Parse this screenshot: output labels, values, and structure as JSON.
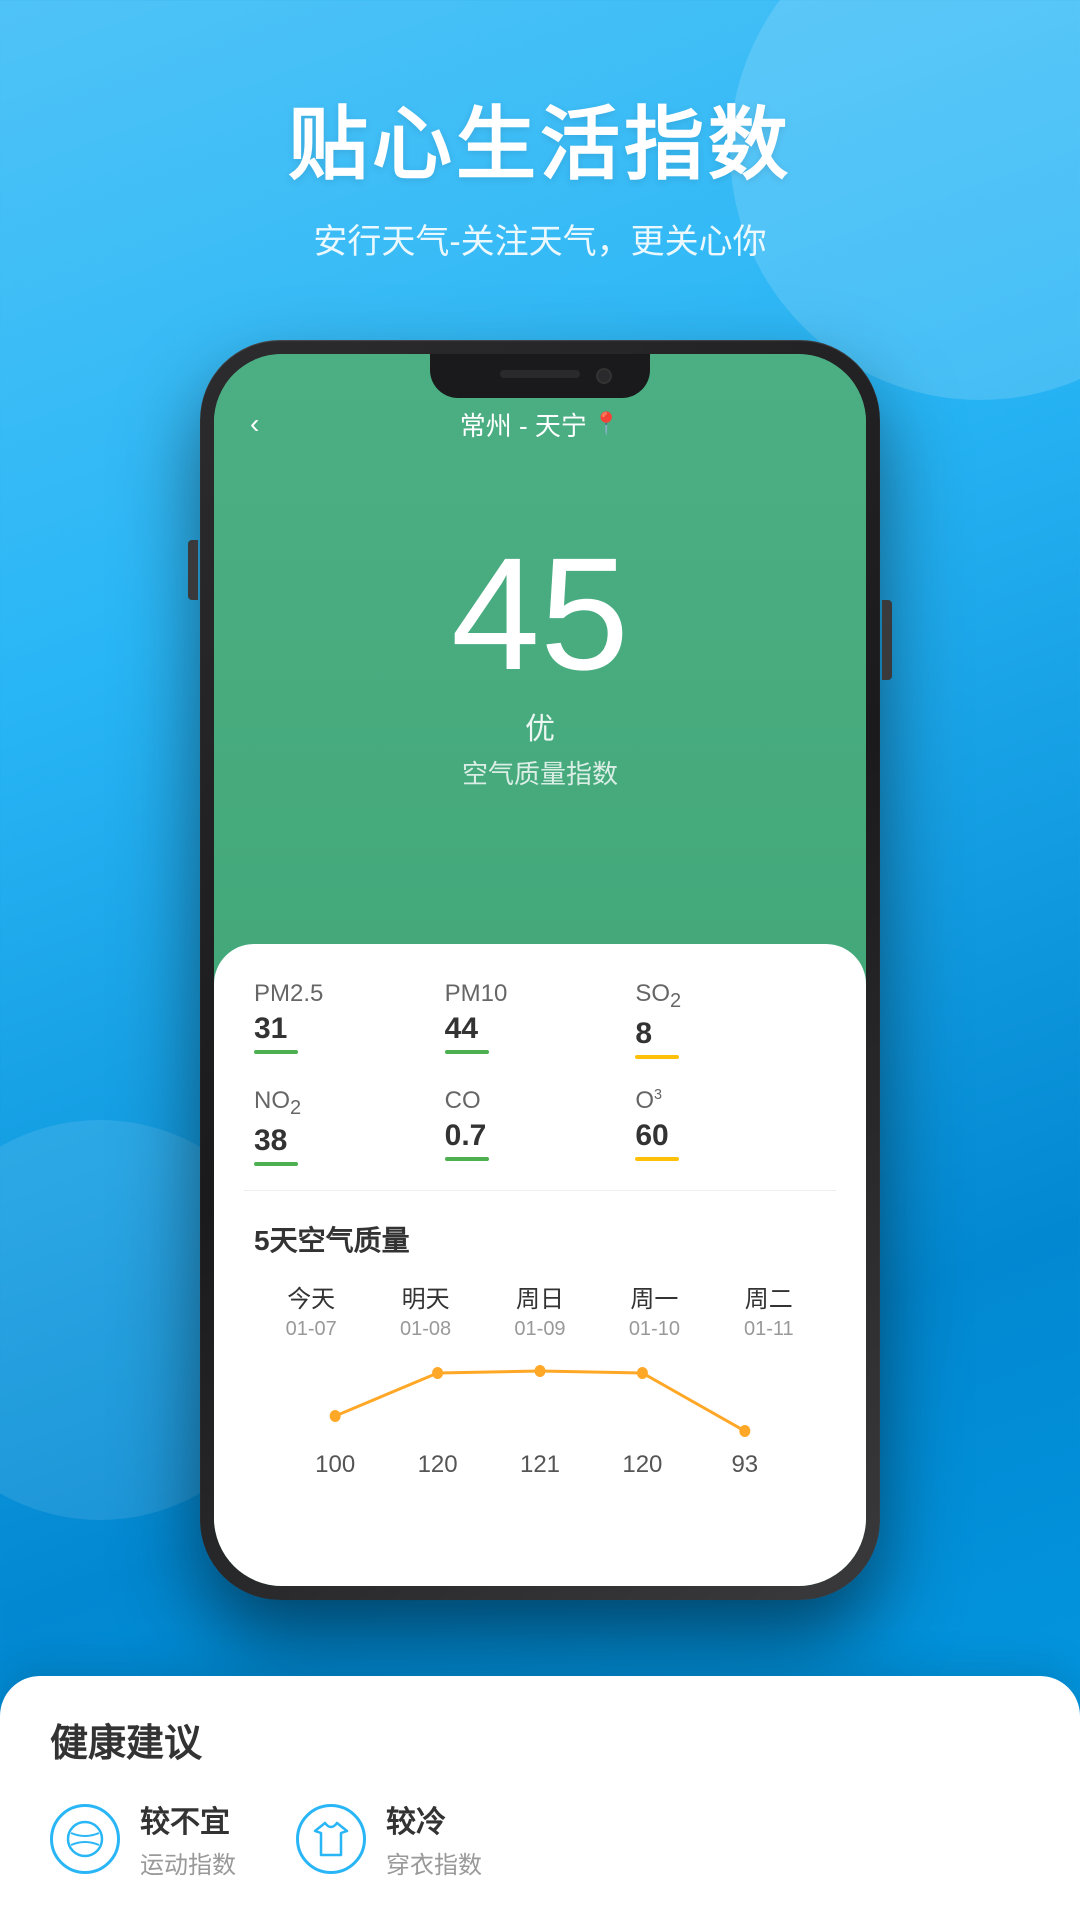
{
  "background": {
    "color1": "#4fc3f7",
    "color2": "#0288d1"
  },
  "header": {
    "main_title": "贴心生活指数",
    "sub_title": "安行天气-关注天气，更关心你"
  },
  "phone": {
    "status_bar": {
      "location": "常州 - 天宁",
      "back_label": "‹"
    },
    "aqi": {
      "value": "45",
      "quality": "优",
      "label": "空气质量指数"
    },
    "pollutants": [
      {
        "name": "PM2.5",
        "value": "31",
        "bar_color": "green"
      },
      {
        "name": "PM10",
        "value": "44",
        "bar_color": "green"
      },
      {
        "name": "SO₂",
        "value": "8",
        "bar_color": "yellow"
      },
      {
        "name": "NO₂",
        "value": "38",
        "bar_color": "green"
      },
      {
        "name": "CO",
        "value": "0.7",
        "bar_color": "green"
      },
      {
        "name": "O³",
        "value": "60",
        "bar_color": "yellow"
      }
    ],
    "five_day": {
      "title": "5天空气质量",
      "days": [
        {
          "label": "今天",
          "date": "01-07",
          "aqi": 100
        },
        {
          "label": "明天",
          "date": "01-08",
          "aqi": 120
        },
        {
          "label": "周日",
          "date": "01-09",
          "aqi": 121
        },
        {
          "label": "周一",
          "date": "01-10",
          "aqi": 120
        },
        {
          "label": "周二",
          "date": "01-11",
          "aqi": 93
        }
      ]
    }
  },
  "health": {
    "title": "健康建议",
    "items": [
      {
        "name": "较不宜",
        "sub": "运动指数",
        "icon": "tennis"
      },
      {
        "name": "较冷",
        "sub": "穿衣指数",
        "icon": "shirt"
      }
    ]
  }
}
